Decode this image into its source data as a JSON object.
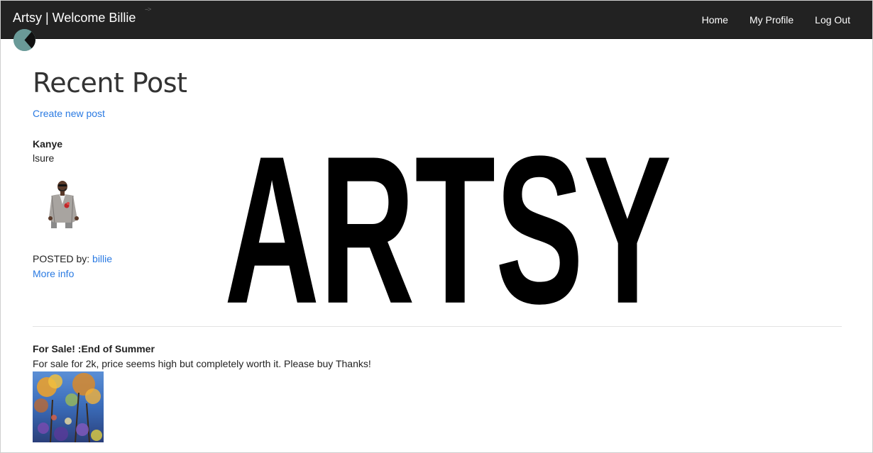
{
  "header": {
    "brand": "Artsy | Welcome Billie",
    "nav": {
      "home": "Home",
      "profile": "My Profile",
      "logout": "Log Out"
    }
  },
  "main": {
    "title": "Recent Post",
    "create_link": "Create new post",
    "watermark_text": "ARTSY",
    "posts": [
      {
        "title": "Kanye",
        "body": "lsure",
        "image_icon": "person-in-suit-image",
        "posted_by_label": "POSTED by:",
        "posted_by_user": "billie",
        "more_info": "More info"
      },
      {
        "title": "For Sale! :End of Summer",
        "body": "For sale for 2k, price seems high but completely worth it. Please buy Thanks!",
        "image_icon": "flower-painting-image"
      }
    ]
  },
  "colors": {
    "navbar": "#222222",
    "link": "#2a7ae2",
    "logo": "#6a9a98"
  }
}
